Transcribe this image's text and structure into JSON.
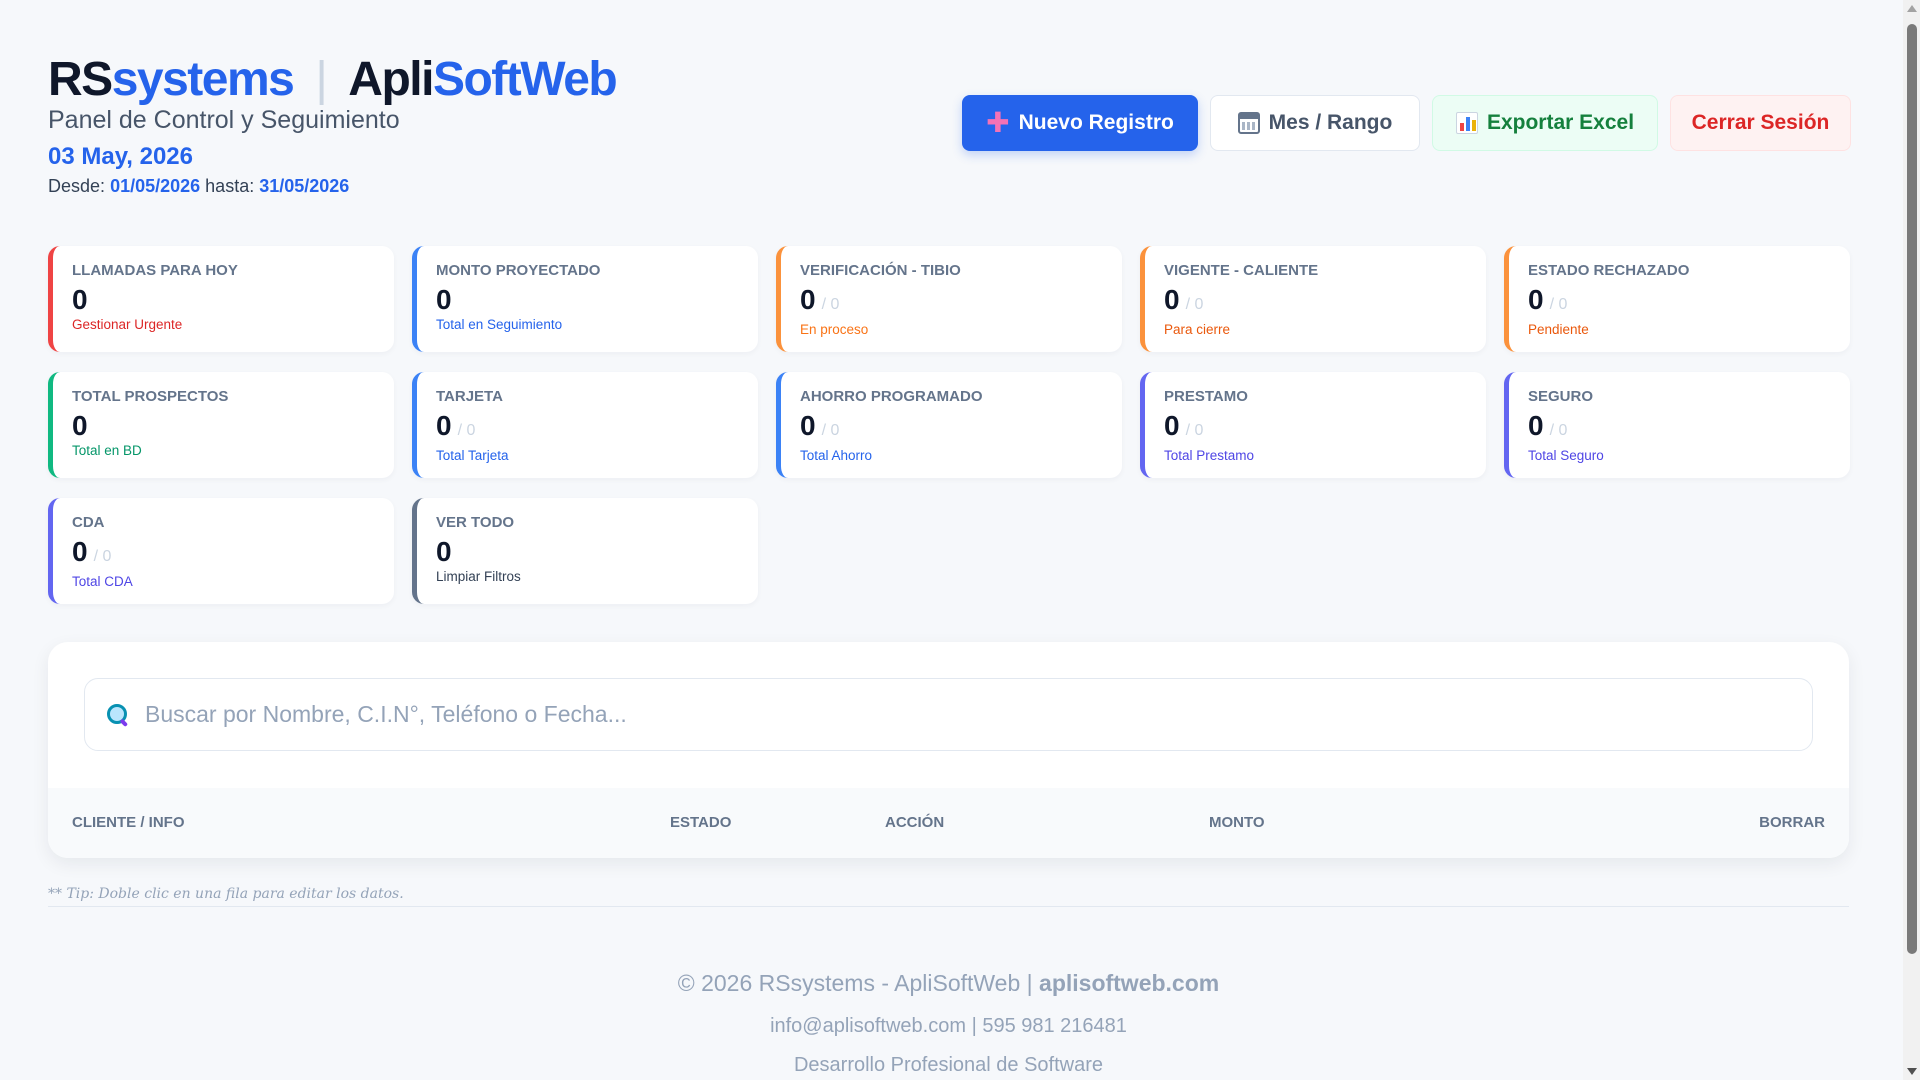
{
  "brand": {
    "part1": "RS",
    "part2": "systems",
    "separator": "|",
    "part3": "Apli",
    "part4": "SoftWeb"
  },
  "header": {
    "subtitle": "Panel de Control y Seguimiento",
    "date": "03 May, 2026",
    "range_from_label": "Desde:",
    "range_from": "01/05/2026",
    "range_to_label": "hasta:",
    "range_to": "31/05/2026"
  },
  "actions": {
    "new_label": "Nuevo Registro",
    "range_label": "Mes / Rango",
    "export_label": "Exportar Excel",
    "logout_label": "Cerrar Sesión"
  },
  "cards": [
    {
      "label": "LLAMADAS PARA HOY",
      "value": "0",
      "of": "",
      "sub": "Gestionar Urgente",
      "color": "#ef4444",
      "sub_color": "#dc2626"
    },
    {
      "label": "MONTO PROYECTADO",
      "value": "0",
      "of": "",
      "sub": "Total en Seguimiento",
      "color": "#3b82f6",
      "sub_color": "#2563eb"
    },
    {
      "label": "VERIFICACIÓN - TIBIO",
      "value": "0",
      "of": "/ 0",
      "sub": "En proceso",
      "color": "#fb923c",
      "sub_color": "#f97316"
    },
    {
      "label": "VIGENTE - CALIENTE",
      "value": "0",
      "of": "/ 0",
      "sub": "Para cierre",
      "color": "#fb923c",
      "sub_color": "#ea580c"
    },
    {
      "label": "ESTADO RECHAZADO",
      "value": "0",
      "of": "/ 0",
      "sub": "Pendiente",
      "color": "#fb923c",
      "sub_color": "#ea580c"
    },
    {
      "label": "TOTAL PROSPECTOS",
      "value": "0",
      "of": "",
      "sub": "Total en BD",
      "color": "#10b981",
      "sub_color": "#059669"
    },
    {
      "label": "TARJETA",
      "value": "0",
      "of": "/ 0",
      "sub": "Total Tarjeta",
      "color": "#3b82f6",
      "sub_color": "#2563eb"
    },
    {
      "label": "AHORRO PROGRAMADO",
      "value": "0",
      "of": "/ 0",
      "sub": "Total Ahorro",
      "color": "#3b82f6",
      "sub_color": "#2563eb"
    },
    {
      "label": "PRESTAMO",
      "value": "0",
      "of": "/ 0",
      "sub": "Total Prestamo",
      "color": "#6366f1",
      "sub_color": "#4f46e5"
    },
    {
      "label": "SEGURO",
      "value": "0",
      "of": "/ 0",
      "sub": "Total Seguro",
      "color": "#6366f1",
      "sub_color": "#4f46e5"
    },
    {
      "label": "CDA",
      "value": "0",
      "of": "/ 0",
      "sub": "Total CDA",
      "color": "#6366f1",
      "sub_color": "#4f46e5"
    },
    {
      "label": "VER TODO",
      "value": "0",
      "of": "",
      "sub": "Limpiar Filtros",
      "color": "#64748b",
      "sub_color": "#334155"
    }
  ],
  "search": {
    "placeholder": "Buscar por Nombre, C.I.N°, Teléfono o Fecha..."
  },
  "table": {
    "columns": [
      "CLIENTE / INFO",
      "ESTADO",
      "ACCIÓN",
      "MONTO",
      "BORRAR"
    ]
  },
  "tip": "** Tip: Doble clic en una fila para editar los datos.",
  "footer": {
    "copyright": "© 2026 RSsystems - ApliSoftWeb |",
    "site": "aplisoftweb.com",
    "contact": "info@aplisoftweb.com | 595 981 216481",
    "tagline": "Desarrollo Profesional de Software"
  },
  "icons": {
    "new": "plus-icon",
    "range": "calendar-icon",
    "export": "bar-chart-icon",
    "search": "magnifier-icon"
  }
}
